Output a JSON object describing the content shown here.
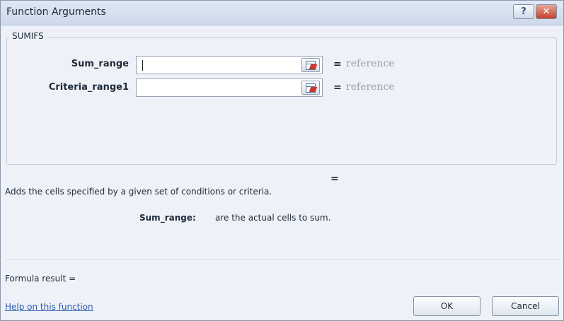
{
  "window": {
    "title": "Function Arguments",
    "help_glyph": "?",
    "close_glyph": "✕"
  },
  "function": {
    "name": "SUMIFS",
    "arguments": [
      {
        "label": "Sum_range",
        "value": "",
        "equals": "=",
        "result": "reference"
      },
      {
        "label": "Criteria_range1",
        "value": "",
        "equals": "=",
        "result": "reference"
      }
    ],
    "result_equals": "=",
    "description": "Adds the cells specified by a given set of conditions or criteria.",
    "arg_help_label": "Sum_range:",
    "arg_help_text": "are the actual cells to sum."
  },
  "footer": {
    "formula_result": "Formula result =",
    "help_link": "Help on this function",
    "ok_label": "OK",
    "cancel_label": "Cancel"
  },
  "icons": {
    "help": "help-icon",
    "close": "close-icon",
    "range_collapse": "collapse-dialog-icon"
  },
  "colors": {
    "titlebar": "#cdd9ea",
    "close_button": "#c4412e",
    "hint_text": "#9aa0a8",
    "link": "#2a58b0"
  }
}
